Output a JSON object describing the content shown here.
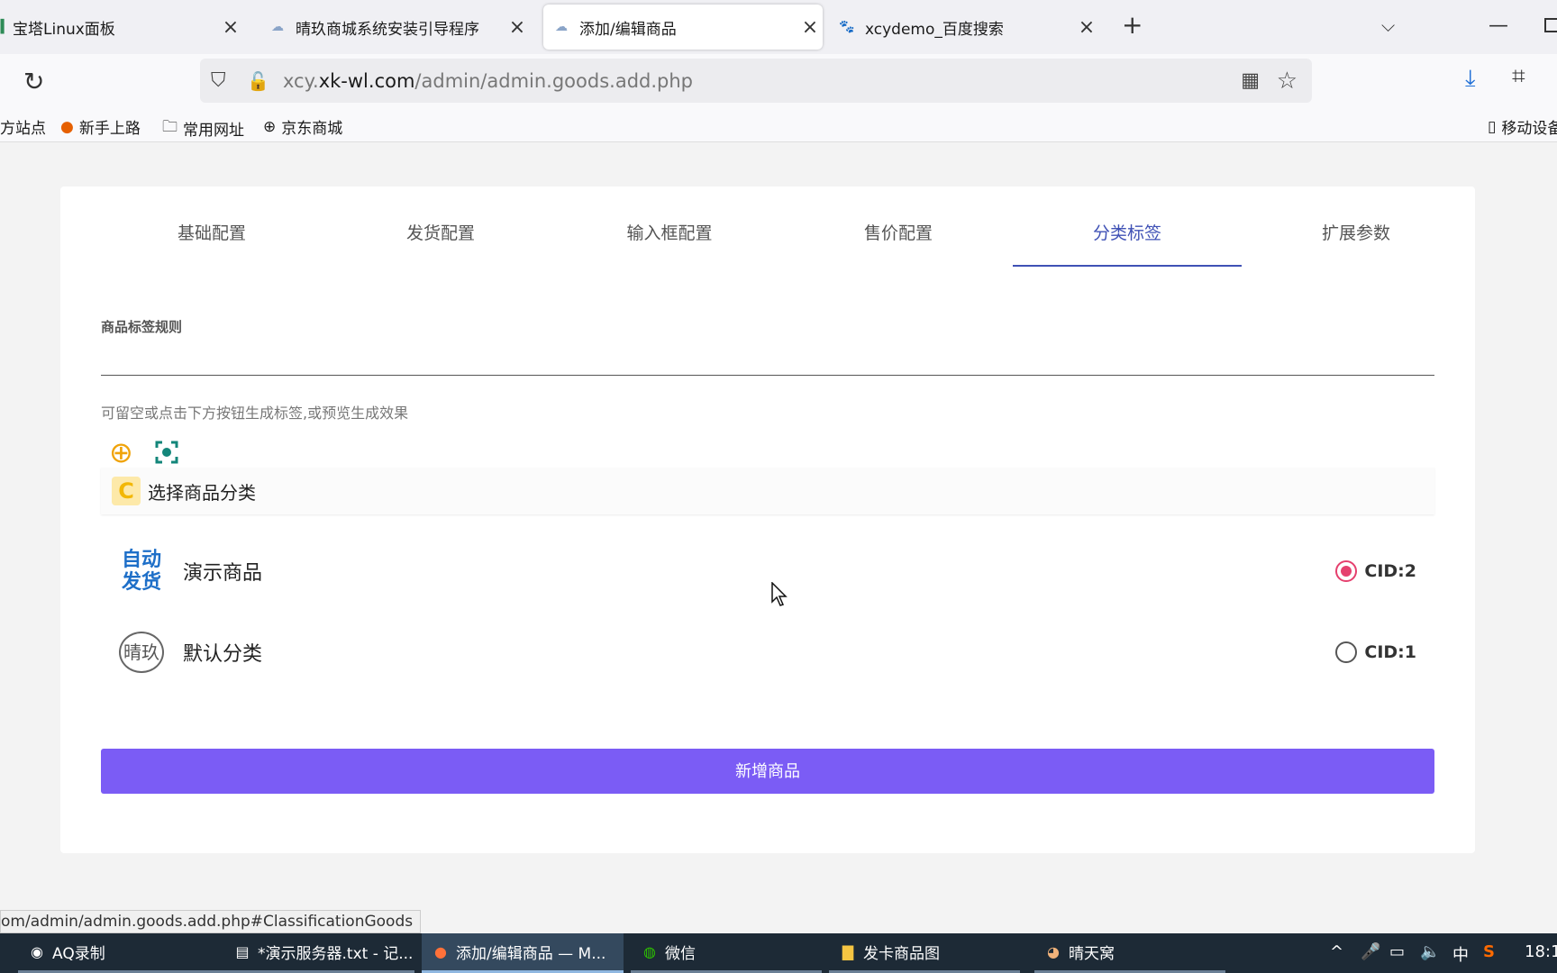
{
  "browser": {
    "tabs": [
      {
        "title": "宝塔Linux面板",
        "close": "×"
      },
      {
        "title": "晴玖商城系统安装引导程序",
        "close": "×"
      },
      {
        "title": "添加/编辑商品",
        "close": "×"
      },
      {
        "title": "xcydemo_百度搜索",
        "close": "×"
      }
    ],
    "new_tab": "+",
    "url_host_prefix": "xcy.",
    "url_host_main": "xk-wl.com",
    "url_path": "/admin/admin.goods.add.php",
    "bookmarks": [
      {
        "label": "方站点",
        "icon": "bookmark-icon"
      },
      {
        "label": "新手上路",
        "icon": "firefox-icon"
      },
      {
        "label": "常用网址",
        "icon": "folder-icon"
      },
      {
        "label": "京东商城",
        "icon": "globe-icon"
      },
      {
        "label": "移动设备",
        "icon": "mobile-icon"
      }
    ],
    "status_url": "om/admin/admin.goods.add.php#ClassificationGoods"
  },
  "page": {
    "tabs": [
      {
        "label": "基础配置"
      },
      {
        "label": "发货配置"
      },
      {
        "label": "输入框配置"
      },
      {
        "label": "售价配置"
      },
      {
        "label": "分类标签",
        "active": true
      },
      {
        "label": "扩展参数"
      }
    ],
    "tag_rule": {
      "label": "商品标签规则",
      "value": "",
      "hint": "可留空或点击下方按钮生成标签,或预览生成效果"
    },
    "category_section": {
      "title": "选择商品分类",
      "categories": [
        {
          "logo_text": "自动\n发货",
          "name": "演示商品",
          "cid_label": "CID:2",
          "selected": true
        },
        {
          "logo_text": "晴玖",
          "name": "默认分类",
          "cid_label": "CID:1",
          "selected": false
        }
      ]
    },
    "submit_label": "新增商品"
  },
  "taskbar": {
    "items": [
      {
        "label": "AQ录制"
      },
      {
        "label": "*演示服务器.txt - 记..."
      },
      {
        "label": "添加/编辑商品 — M..."
      },
      {
        "label": "微信"
      },
      {
        "label": "发卡商品图"
      },
      {
        "label": "晴天窝"
      }
    ],
    "ime": "中",
    "clock": "18:1"
  },
  "colors": {
    "accent_tab": "#3f51b5",
    "submit_button": "#7b5cf5",
    "radio_selected": "#e5406e",
    "add_icon": "#f0a30a"
  }
}
